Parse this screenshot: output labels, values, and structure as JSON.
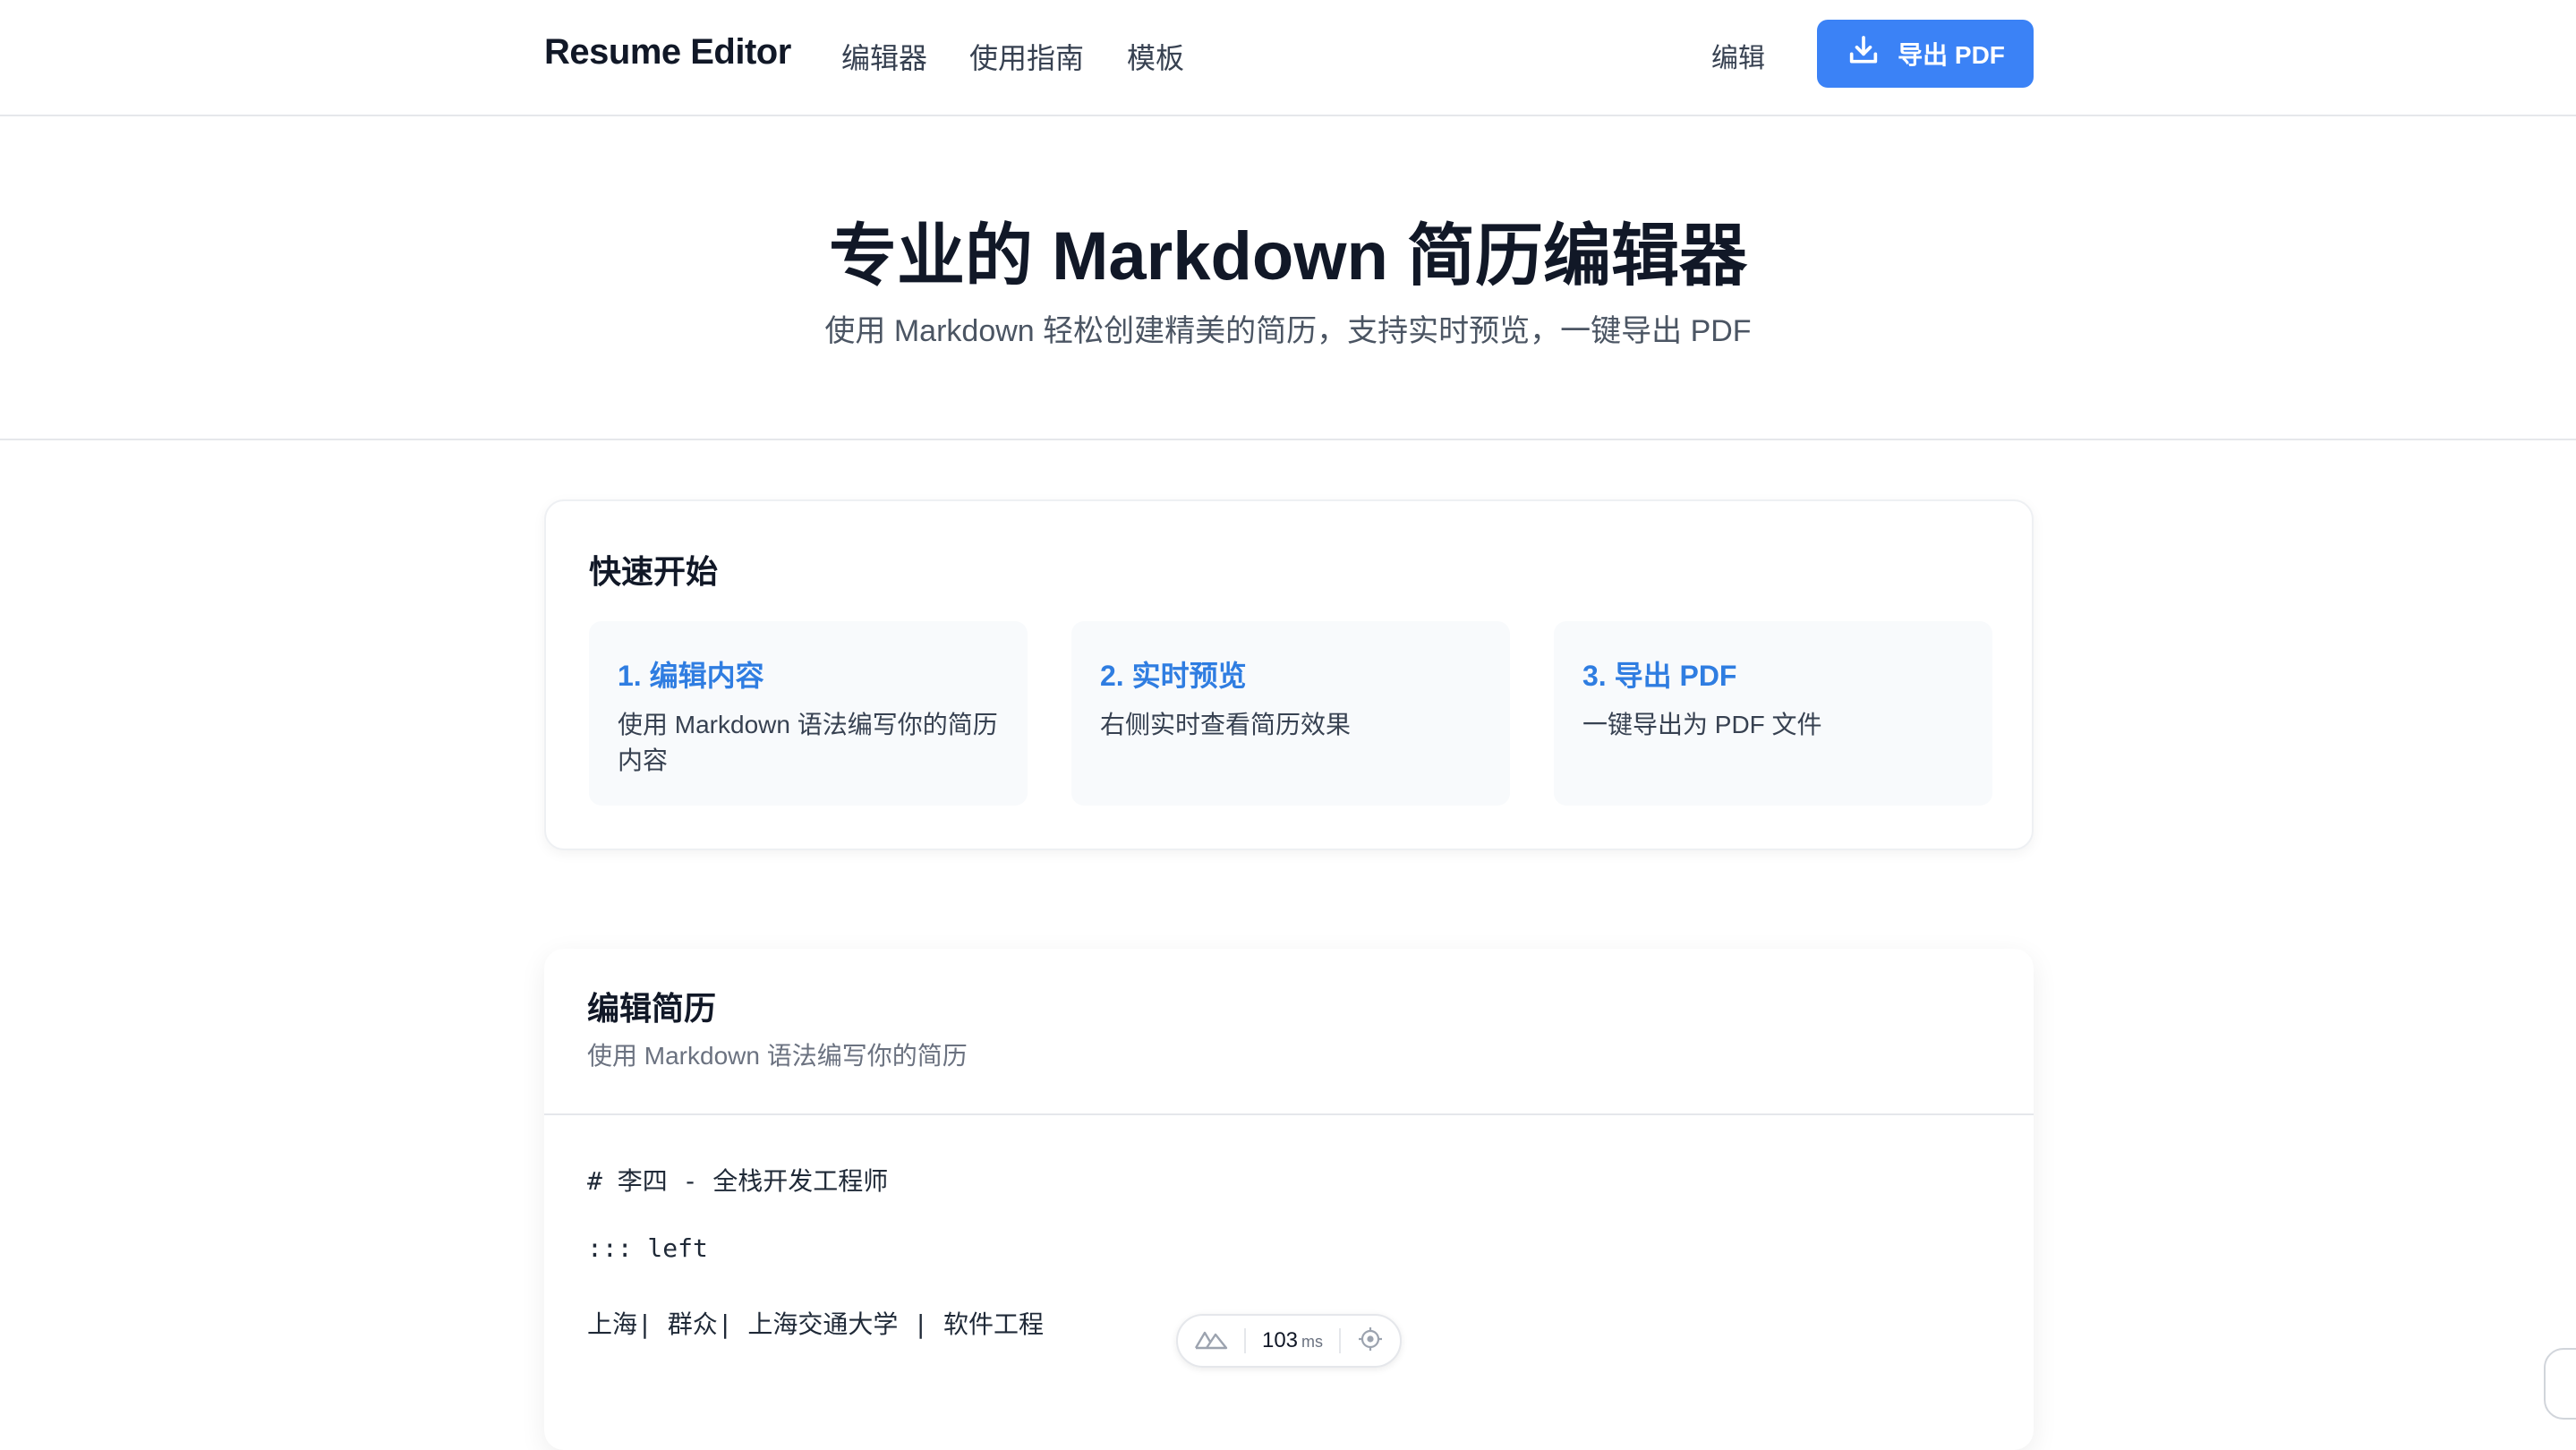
{
  "header": {
    "brand": "Resume Editor",
    "nav": [
      "编辑器",
      "使用指南",
      "模板"
    ],
    "edit_link": "编辑",
    "export_label": "导出 PDF"
  },
  "hero": {
    "title": "专业的 Markdown 简历编辑器",
    "subtitle": "使用 Markdown 轻松创建精美的简历，支持实时预览，一键导出 PDF"
  },
  "quick_start": {
    "title": "快速开始",
    "steps": [
      {
        "title": "1. 编辑内容",
        "desc": "使用 Markdown 语法编写你的简历内容"
      },
      {
        "title": "2. 实时预览",
        "desc": "右侧实时查看简历效果"
      },
      {
        "title": "3. 导出 PDF",
        "desc": "一键导出为 PDF 文件"
      }
    ]
  },
  "editor": {
    "title": "编辑简历",
    "subtitle": "使用 Markdown 语法编写你的简历",
    "lines": [
      "# 李四 - 全栈开发工程师",
      "::: left",
      "上海| 群众| 上海交通大学 | 软件工程"
    ]
  },
  "devtools": {
    "value": "103",
    "unit": "ms"
  },
  "colors": {
    "accent": "#3b82f6",
    "step_title": "#2f7de1",
    "step_bg": "#f8fafc"
  }
}
